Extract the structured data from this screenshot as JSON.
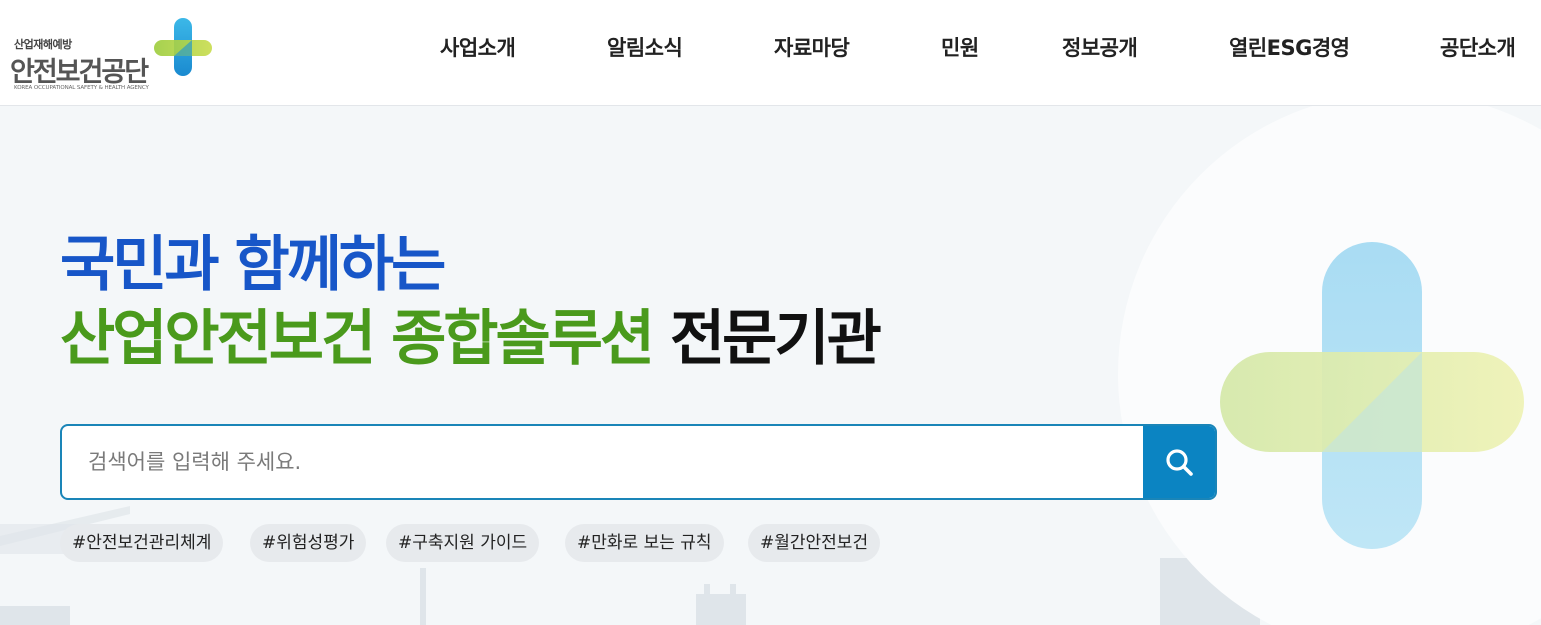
{
  "logo": {
    "subtitle": "산업재해예방",
    "name": "안전보건공단",
    "english": "KOREA OCCUPATIONAL SAFETY & HEALTH AGENCY"
  },
  "nav": {
    "items": [
      "사업소개",
      "알림소식",
      "자료마당",
      "민원",
      "정보공개",
      "열린ESG경영",
      "공단소개"
    ]
  },
  "hero": {
    "line1": "국민과 함께하는",
    "line2_green": "산업안전보건 종합솔루션",
    "line2_black": "전문기관"
  },
  "search": {
    "placeholder": "검색어를 입력해 주세요.",
    "value": ""
  },
  "tags": [
    "#안전보건관리체계",
    "#위험성평가",
    "#구축지원 가이드",
    "#만화로 보는 규칙",
    "#월간안전보건"
  ],
  "colors": {
    "headline_blue": "#1756c8",
    "headline_green": "#4a9a1c",
    "search_accent": "#0b84c2"
  },
  "icons": {
    "logo": "cross-logo-icon",
    "search": "search-icon",
    "hero_graphic": "cross-graphic-icon"
  }
}
